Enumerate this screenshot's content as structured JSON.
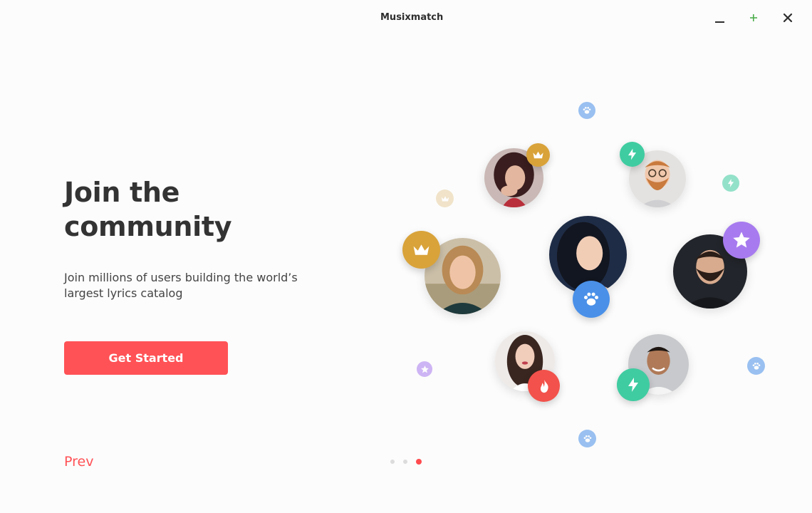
{
  "window": {
    "title": "Musixmatch",
    "controls": [
      "minimize-icon",
      "maximize-icon",
      "close-icon"
    ]
  },
  "main": {
    "heading_line1": "Join the",
    "heading_line2": "community",
    "subtitle": "Join millions of users building the world’s largest lyrics catalog",
    "cta_label": "Get Started",
    "prev_label": "Prev"
  },
  "pagination": {
    "total": 3,
    "active": 3
  },
  "colors": {
    "accent": "#ff5256",
    "crown": "#d9a33a",
    "bolt": "#3fcca0",
    "paw": "#4a90e8",
    "star": "#a77bef",
    "fire": "#f2524b"
  },
  "illustration": {
    "avatars": [
      "avatar-woman-red-hair",
      "avatar-man-beard-glasses",
      "avatar-woman-blonde",
      "avatar-woman-dark-hair",
      "avatar-man-dark-beard",
      "avatar-woman-long-hair",
      "avatar-man-smiling"
    ],
    "badges": [
      "crown-icon",
      "bolt-icon",
      "paw-icon",
      "star-icon",
      "fire-icon"
    ]
  }
}
